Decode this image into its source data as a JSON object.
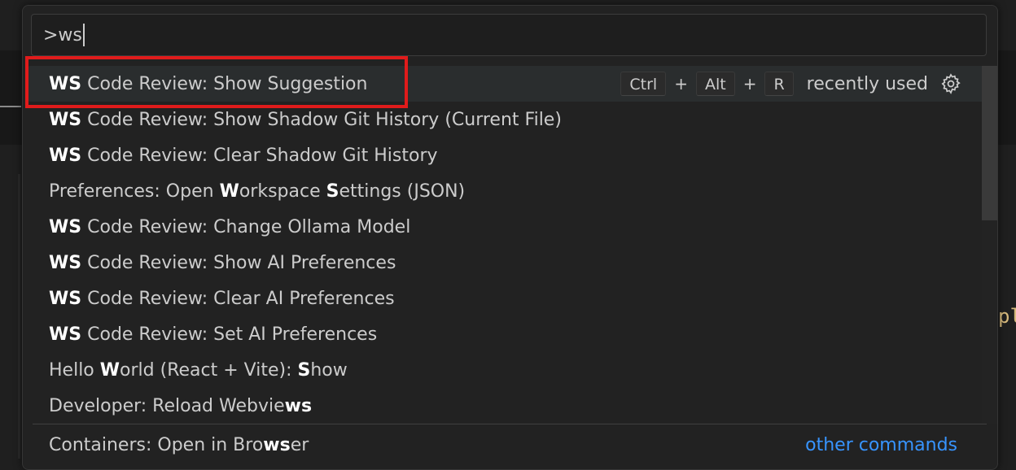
{
  "quick_open": {
    "input_value": ">ws",
    "items": [
      {
        "segments": [
          {
            "t": "WS",
            "b": true
          },
          {
            "t": " Code Review: Show Suggestion",
            "b": false
          }
        ]
      },
      {
        "segments": [
          {
            "t": "WS",
            "b": true
          },
          {
            "t": " Code Review: Show Shadow Git History (Current File)",
            "b": false
          }
        ]
      },
      {
        "segments": [
          {
            "t": "WS",
            "b": true
          },
          {
            "t": " Code Review: Clear Shadow Git History",
            "b": false
          }
        ]
      },
      {
        "segments": [
          {
            "t": "Preferences: Open ",
            "b": false
          },
          {
            "t": "W",
            "b": true
          },
          {
            "t": "orkspace ",
            "b": false
          },
          {
            "t": "S",
            "b": true
          },
          {
            "t": "ettings (JSON)",
            "b": false
          }
        ]
      },
      {
        "segments": [
          {
            "t": "WS",
            "b": true
          },
          {
            "t": " Code Review: Change Ollama Model",
            "b": false
          }
        ]
      },
      {
        "segments": [
          {
            "t": "WS",
            "b": true
          },
          {
            "t": " Code Review: Show AI Preferences",
            "b": false
          }
        ]
      },
      {
        "segments": [
          {
            "t": "WS",
            "b": true
          },
          {
            "t": " Code Review: Clear AI Preferences",
            "b": false
          }
        ]
      },
      {
        "segments": [
          {
            "t": "WS",
            "b": true
          },
          {
            "t": " Code Review: Set AI Preferences",
            "b": false
          }
        ]
      },
      {
        "segments": [
          {
            "t": "Hello ",
            "b": false
          },
          {
            "t": "W",
            "b": true
          },
          {
            "t": "orld (React + Vite): ",
            "b": false
          },
          {
            "t": "S",
            "b": true
          },
          {
            "t": "how",
            "b": false
          }
        ]
      },
      {
        "segments": [
          {
            "t": "Developer: Reload Webvie",
            "b": false
          },
          {
            "t": "ws",
            "b": true
          }
        ]
      }
    ],
    "active_index": 0,
    "keybinding": {
      "keys": [
        "Ctrl",
        "Alt",
        "R"
      ],
      "separator": "+"
    },
    "recently_used_label": "recently used",
    "footer_item": {
      "segments": [
        {
          "t": "Containers: Open in Bro",
          "b": false
        },
        {
          "t": "ws",
          "b": true
        },
        {
          "t": "er",
          "b": false
        }
      ]
    },
    "other_commands_label": "other commands"
  },
  "editor": {
    "code_fragment": "pl"
  },
  "icons": {
    "gear": "gear-icon"
  },
  "colors": {
    "link": "#3794ff",
    "highlight_box": "#e01b1b",
    "active_row": "#2a2d2e"
  }
}
